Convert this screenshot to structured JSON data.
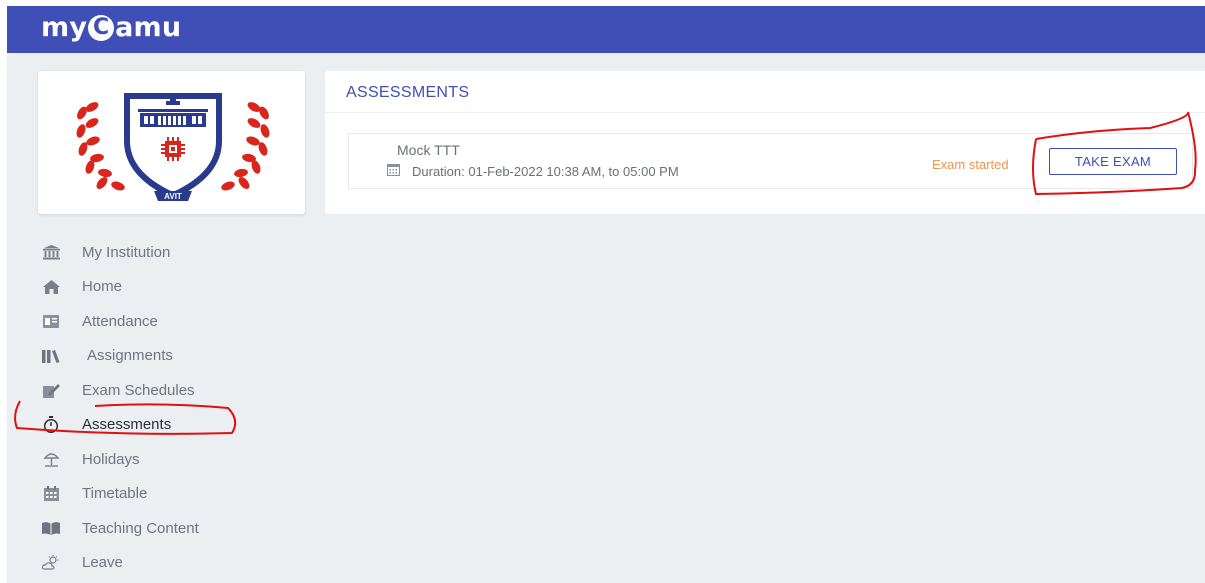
{
  "brand": {
    "prefix": "my",
    "c": "C",
    "suffix": "amu"
  },
  "logo": {
    "text": "AVIT"
  },
  "sidebar": {
    "items": [
      {
        "label": "My Institution",
        "icon": "institution-icon"
      },
      {
        "label": "Home",
        "icon": "home-icon"
      },
      {
        "label": "Attendance",
        "icon": "attendance-icon"
      },
      {
        "label": "Assignments",
        "icon": "books-icon"
      },
      {
        "label": "Exam Schedules",
        "icon": "edit-icon"
      },
      {
        "label": "Assessments",
        "icon": "stopwatch-icon",
        "active": true
      },
      {
        "label": "Holidays",
        "icon": "beach-umbrella-icon"
      },
      {
        "label": "Timetable",
        "icon": "calendar-icon"
      },
      {
        "label": "Teaching Content",
        "icon": "open-book-icon"
      },
      {
        "label": "Leave",
        "icon": "weather-icon"
      }
    ]
  },
  "main": {
    "title": "ASSESSMENTS",
    "exam": {
      "name": "Mock TTT",
      "duration": "Duration: 01-Feb-2022 10:38 AM, to 05:00 PM",
      "status": "Exam started",
      "action_label": "TAKE EXAM"
    }
  },
  "colors": {
    "primary": "#3f4fb5",
    "status_orange": "#f0964e",
    "background": "#eceff2",
    "annotation_red": "#e01010"
  }
}
